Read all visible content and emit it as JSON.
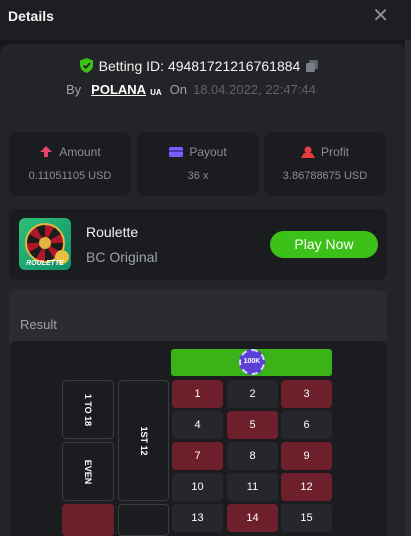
{
  "header": {
    "title": "Details",
    "close_glyph": "✕"
  },
  "bet": {
    "betting_id_label": "Betting ID:",
    "betting_id": "49481721216761884",
    "by_label": "By",
    "username": "POLANA",
    "user_flag": "UA",
    "on_label": "On",
    "datetime": "18.04.2022, 22:47:44"
  },
  "stats": {
    "amount": {
      "label": "Amount",
      "value": "0.11051105 USD",
      "icon": "amount-icon"
    },
    "payout": {
      "label": "Payout",
      "value": "36 x",
      "icon": "wallet-icon"
    },
    "profit": {
      "label": "Profit",
      "value": "3.86788675 USD",
      "icon": "profit-icon"
    }
  },
  "game": {
    "name": "Roulette",
    "provider": "BC Original",
    "thumb_label": "ROULETTE",
    "play_label": "Play Now"
  },
  "result": {
    "label": "Result",
    "chip_label": "100K",
    "outside": {
      "range": "1 TO 18",
      "even": "EVEN",
      "dozen": "1ST 12"
    },
    "numbers": [
      {
        "n": "1",
        "color": "red"
      },
      {
        "n": "2",
        "color": "dark"
      },
      {
        "n": "3",
        "color": "red"
      },
      {
        "n": "4",
        "color": "dark"
      },
      {
        "n": "5",
        "color": "red"
      },
      {
        "n": "6",
        "color": "dark"
      },
      {
        "n": "7",
        "color": "red"
      },
      {
        "n": "8",
        "color": "dark"
      },
      {
        "n": "9",
        "color": "red"
      },
      {
        "n": "10",
        "color": "dark"
      },
      {
        "n": "11",
        "color": "dark"
      },
      {
        "n": "12",
        "color": "red"
      },
      {
        "n": "13",
        "color": "dark"
      },
      {
        "n": "14",
        "color": "red"
      },
      {
        "n": "15",
        "color": "dark"
      }
    ]
  },
  "colors": {
    "accent_green": "#3bc117",
    "red_cell": "#6d1f2b",
    "dark_cell": "#25272c"
  }
}
